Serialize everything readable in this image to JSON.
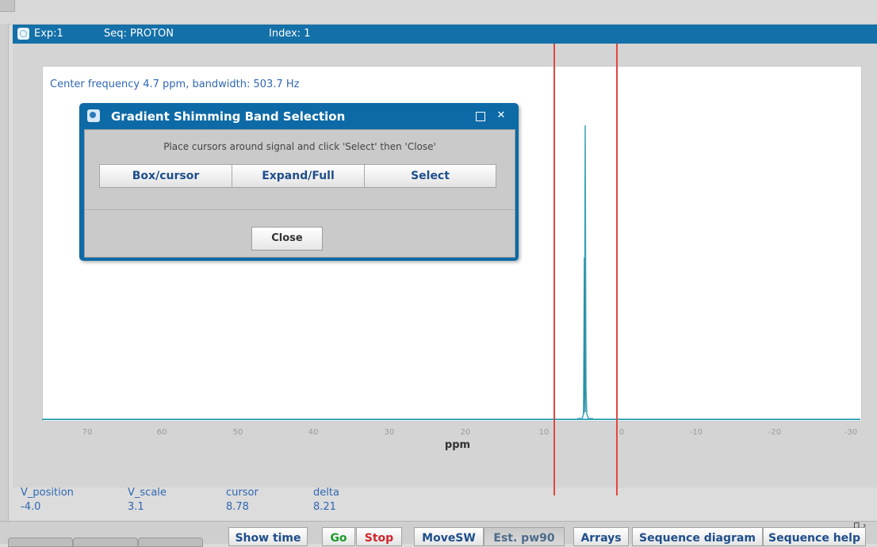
{
  "header": {
    "exp": "Exp:1",
    "seq": "Seq: PROTON",
    "index": "Index: 1"
  },
  "plot": {
    "center_frequency": "Center frequency 4.7 ppm, bandwidth: 503.7 Hz",
    "axis_ticks": [
      "70",
      "60",
      "50",
      "40",
      "30",
      "20",
      "10",
      "0",
      "-10",
      "-20",
      "-30"
    ],
    "axis_label": "ppm",
    "peak_position_ppm": 4.7,
    "cursor_left_ppm": 8.78,
    "cursor_right_ppm": 0.57,
    "line_color": "#3aa3b8",
    "cursor_color": "#e3463f"
  },
  "status": {
    "v_position_label": "V_position",
    "v_position_value": "-4.0",
    "v_scale_label": "V_scale",
    "v_scale_value": "3.1",
    "cursor_label": "cursor",
    "cursor_value": "8.78",
    "delta_label": "delta",
    "delta_value": "8.21"
  },
  "dialog": {
    "title": "Gradient Shimming Band Selection",
    "instruction": "Place cursors around signal and click 'Select' then 'Close'",
    "buttons": [
      "Box/cursor",
      "Expand/Full",
      "Select"
    ],
    "close_label": "Close",
    "maximize_icon": "maximize-icon",
    "close_icon": "close-icon"
  },
  "toolbar": {
    "show_time": "Show time",
    "go": "Go",
    "stop": "Stop",
    "movesw": "MoveSW",
    "est_pw90": "Est. pw90",
    "arrays": "Arrays",
    "sequence_diagram": "Sequence diagram",
    "sequence_help": "Sequence help"
  }
}
